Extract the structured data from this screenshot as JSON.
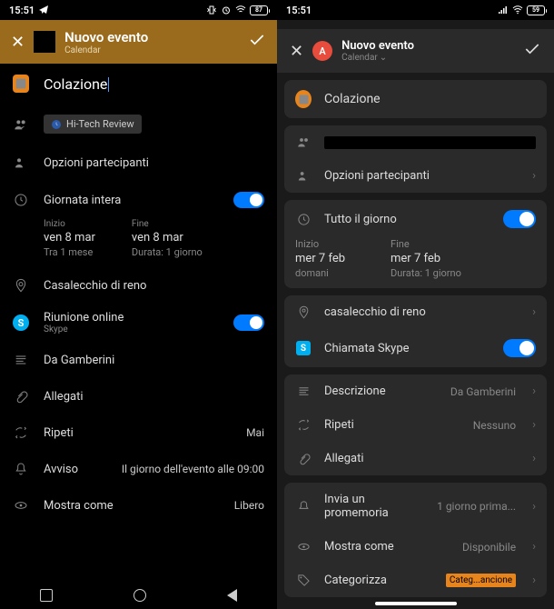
{
  "left": {
    "status": {
      "time": "15:51",
      "battery": "87"
    },
    "header": {
      "title": "Nuovo evento",
      "subtitle": "Calendar"
    },
    "event_title": "Colazione",
    "chip_label": "Hi-Tech Review",
    "participants_options": "Opzioni partecipanti",
    "allday_label": "Giornata intera",
    "start": {
      "label": "Inizio",
      "date": "ven 8 mar",
      "sub": "Tra 1 mese"
    },
    "end": {
      "label": "Fine",
      "date": "ven 8 mar",
      "sub": "Durata: 1 giorno"
    },
    "location": "Casalecchio di reno",
    "online_meeting": {
      "title": "Riunione online",
      "sub": "Skype"
    },
    "description": "Da Gamberini",
    "attachments": "Allegati",
    "repeat": {
      "label": "Ripeti",
      "value": "Mai"
    },
    "alert": {
      "label": "Avviso",
      "value": "Il giorno dell'evento alle 09:00"
    },
    "show_as": {
      "label": "Mostra come",
      "value": "Libero"
    }
  },
  "right": {
    "status": {
      "time": "15:51",
      "battery": "59"
    },
    "header": {
      "avatar": "A",
      "title": "Nuovo evento",
      "subtitle": "Calendar"
    },
    "event_title": "Colazione",
    "participants_options": "Opzioni partecipanti",
    "allday_label": "Tutto il giorno",
    "start": {
      "label": "Inizio",
      "date": "mer 7 feb",
      "sub": "domani"
    },
    "end": {
      "label": "Fine",
      "date": "mer 7 feb",
      "sub": "Durata: 1 giorno"
    },
    "location": "casalecchio di reno",
    "skype": "Chiamata Skype",
    "description": {
      "label": "Descrizione",
      "value": "Da Gamberini"
    },
    "repeat": {
      "label": "Ripeti",
      "value": "Nessuno"
    },
    "attachments": "Allegati",
    "reminder": {
      "label": "Invia un promemoria",
      "value": "1 giorno prima..."
    },
    "show_as": {
      "label": "Mostra come",
      "value": "Disponibile"
    },
    "categorize": {
      "label": "Categorizza",
      "value": "Categ...ancione"
    }
  }
}
